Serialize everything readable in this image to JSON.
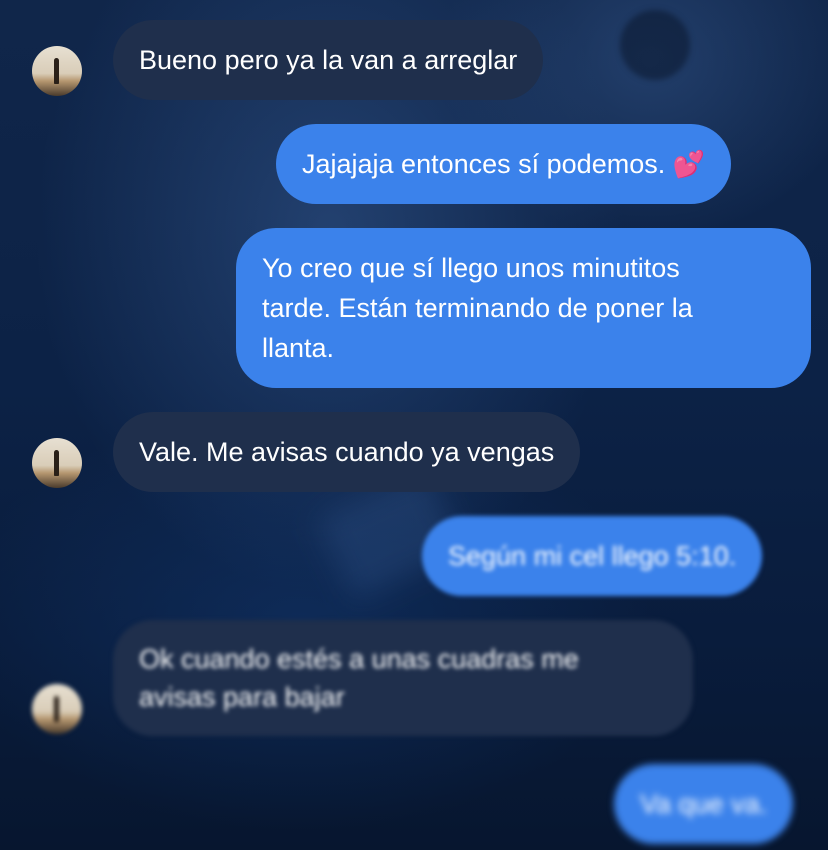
{
  "colors": {
    "incoming_bubble": "#1f2f4c",
    "outgoing_bubble": "#3b82eb",
    "background": "#0b1a33",
    "text": "#ffffff"
  },
  "messages": [
    {
      "direction": "incoming",
      "text": "Bueno pero ya la van a arreglar"
    },
    {
      "direction": "outgoing",
      "text": "Jajajaja entonces sí podemos.",
      "emoji": "💕"
    },
    {
      "direction": "outgoing",
      "lines": [
        "Yo creo que sí llego unos minutitos",
        "tarde. Están terminando de poner la",
        "llanta."
      ]
    },
    {
      "direction": "incoming",
      "text": "Vale. Me avisas cuando ya vengas"
    },
    {
      "direction": "outgoing",
      "text": "Según mi cel llego 5:10."
    },
    {
      "direction": "incoming",
      "lines": [
        "Ok cuando estés a unas cuadras me",
        "avisas para bajar"
      ]
    },
    {
      "direction": "outgoing",
      "text": "Va que va."
    }
  ]
}
